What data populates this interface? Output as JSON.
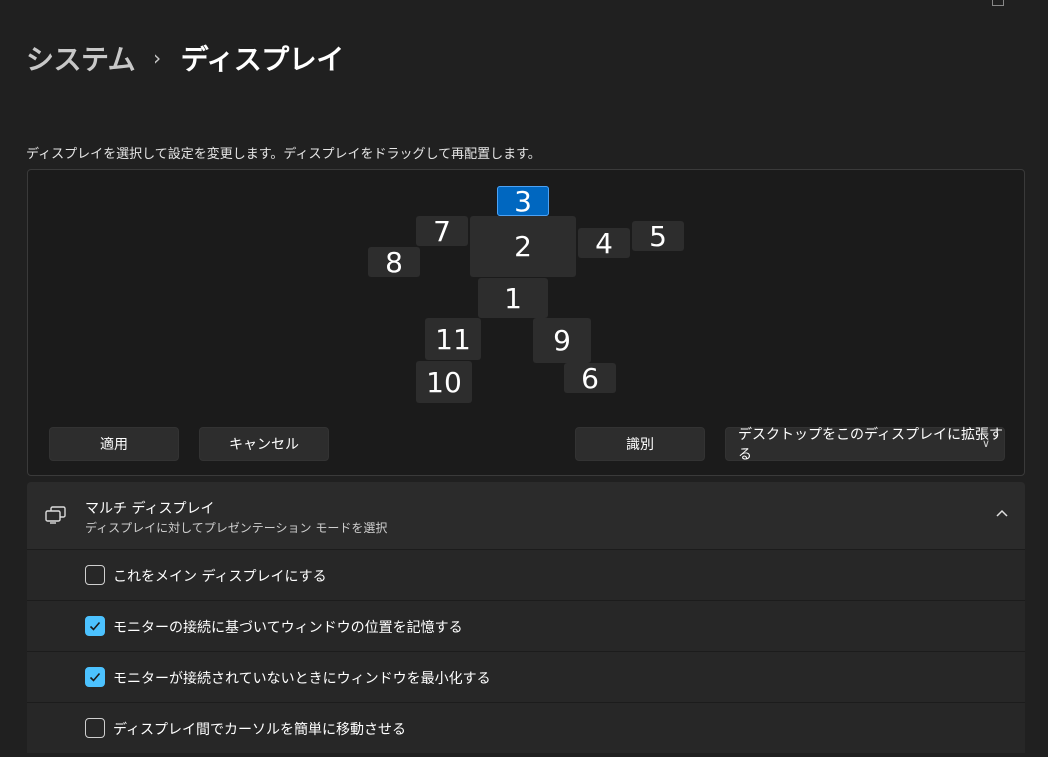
{
  "breadcrumb": {
    "parent": "システム",
    "separator": "›",
    "current": "ディスプレイ"
  },
  "instruction": "ディスプレイを選択して設定を変更します。ディスプレイをドラッグして再配置します。",
  "monitors": [
    {
      "label": "3",
      "selected": true
    },
    {
      "label": "7"
    },
    {
      "label": "2"
    },
    {
      "label": "4"
    },
    {
      "label": "5"
    },
    {
      "label": "8"
    },
    {
      "label": "1"
    },
    {
      "label": "11"
    },
    {
      "label": "9"
    },
    {
      "label": "10"
    },
    {
      "label": "6"
    }
  ],
  "buttons": {
    "apply": "適用",
    "cancel": "キャンセル",
    "identify": "識別",
    "mode_dropdown": "デスクトップをこのディスプレイに拡張する"
  },
  "multi_display": {
    "title": "マルチ ディスプレイ",
    "subtitle": "ディスプレイに対してプレゼンテーション モードを選択",
    "icon": "multi-monitor-icon",
    "expanded": true
  },
  "options": [
    {
      "label": "これをメイン ディスプレイにする",
      "checked": false
    },
    {
      "label": "モニターの接続に基づいてウィンドウの位置を記憶する",
      "checked": true
    },
    {
      "label": "モニターが接続されていないときにウィンドウを最小化する",
      "checked": true
    },
    {
      "label": "ディスプレイ間でカーソルを簡単に移動させる",
      "checked": false
    }
  ],
  "colors": {
    "accent": "#0067c0",
    "checkbox": "#4cc2ff",
    "background": "#202020"
  }
}
